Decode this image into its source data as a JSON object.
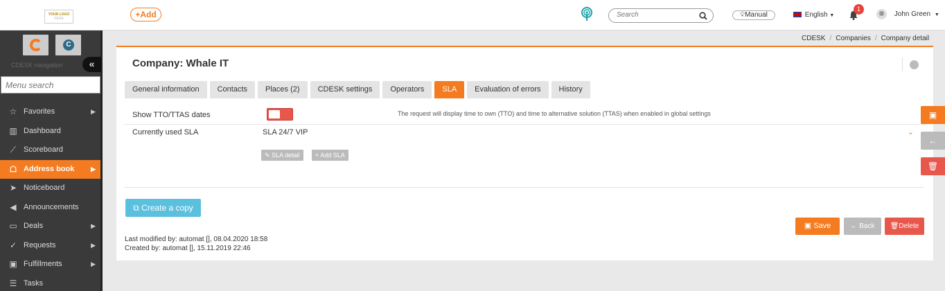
{
  "topbar": {
    "logo_line1": "YOUR LOGO",
    "logo_line2": "HERE",
    "add_label": "+Add",
    "search_placeholder": "Search",
    "manual_label": "Manual",
    "language": "English",
    "notifications_count": "1",
    "user_name": "John Green"
  },
  "sidebar": {
    "nav_label": "CDESK navigation",
    "collapse_label": "«",
    "menu_search_placeholder": "Menu search",
    "items": [
      {
        "label": "Favorites",
        "icon": "star-icon",
        "has_arrow": true
      },
      {
        "label": "Dashboard",
        "icon": "bar-chart-icon",
        "has_arrow": false
      },
      {
        "label": "Scoreboard",
        "icon": "line-chart-icon",
        "has_arrow": false
      },
      {
        "label": "Address book",
        "icon": "address-book-icon",
        "has_arrow": true,
        "active": true
      },
      {
        "label": "Noticeboard",
        "icon": "paper-plane-icon",
        "has_arrow": false
      },
      {
        "label": "Announcements",
        "icon": "megaphone-icon",
        "has_arrow": false
      },
      {
        "label": "Deals",
        "icon": "card-icon",
        "has_arrow": true
      },
      {
        "label": "Requests",
        "icon": "check-circle-icon",
        "has_arrow": true
      },
      {
        "label": "Fulfillments",
        "icon": "box-icon",
        "has_arrow": true
      },
      {
        "label": "Tasks",
        "icon": "list-icon",
        "has_arrow": false
      }
    ]
  },
  "breadcrumb": [
    "CDESK",
    "Companies",
    "Company detail"
  ],
  "main": {
    "title": "Company: Whale IT",
    "tabs": [
      {
        "label": "General information",
        "active": false
      },
      {
        "label": "Contacts",
        "active": false
      },
      {
        "label": "Places (2)",
        "active": false
      },
      {
        "label": "CDESK settings",
        "active": false
      },
      {
        "label": "Operators",
        "active": false
      },
      {
        "label": "SLA",
        "active": true
      },
      {
        "label": "Evaluation of errors",
        "active": false
      },
      {
        "label": "History",
        "active": false
      }
    ],
    "show_dates_label": "Show TTO/TTAS dates",
    "show_dates_hint": "The request will display time to own (TTO) and time to alternative solution (TTAS) when enabled in global settings",
    "current_sla_label": "Currently used SLA",
    "current_sla_value": "SLA 24/7 VIP",
    "sla_detail_label": "SLA detail",
    "add_sla_label": "Add SLA",
    "create_copy_label": "Create a copy",
    "save_label": "Save",
    "back_label": "Back",
    "delete_label": "Delete",
    "last_modified": "Last modified by: automat  [], 08.04.2020 18:58",
    "created_by": "Created by: automat  [], 15.11.2019 22:46"
  },
  "colors": {
    "accent": "#f47b20",
    "danger": "#e8574c",
    "info": "#5bc0de",
    "sidebar_bg": "#3a3a3a"
  }
}
